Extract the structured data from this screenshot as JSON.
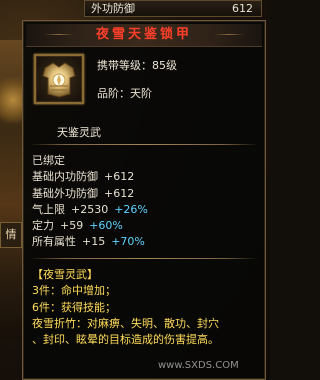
{
  "top_bar": {
    "label": "外功防御",
    "value": "612"
  },
  "side_tab": {
    "label": "情"
  },
  "tooltip": {
    "title": "夜雪天鉴锁甲",
    "carry_level": "携带等级：85级",
    "grade": "品阶：天阶",
    "item_name": "天鉴灵武",
    "bound": "已绑定",
    "stats": [
      {
        "label": "基础内功防御",
        "value": "+612",
        "pct": ""
      },
      {
        "label": "基础外功防御",
        "value": "+612",
        "pct": ""
      },
      {
        "label": "气上限",
        "value": "+2530",
        "pct": "+26%"
      },
      {
        "label": "定力",
        "value": "+59",
        "pct": "+60%"
      },
      {
        "label": "所有属性",
        "value": "+15",
        "pct": "+70%"
      }
    ],
    "set": {
      "title": "【夜雪灵武】",
      "lines": [
        "3件：命中增加；",
        "6件：获得技能；"
      ],
      "desc_1": "夜雪折竹：对麻痹、失明、散功、封穴",
      "desc_2": "、封印、眩晕的目标造成的伤害提高。"
    },
    "icon": "armor-icon"
  },
  "watermark": "www.SXDS.COM",
  "colors": {
    "title": "#ff3f2a",
    "set_text": "#ffdc5a",
    "percent": "#5fd3ff",
    "normal": "#e6e0cf"
  }
}
